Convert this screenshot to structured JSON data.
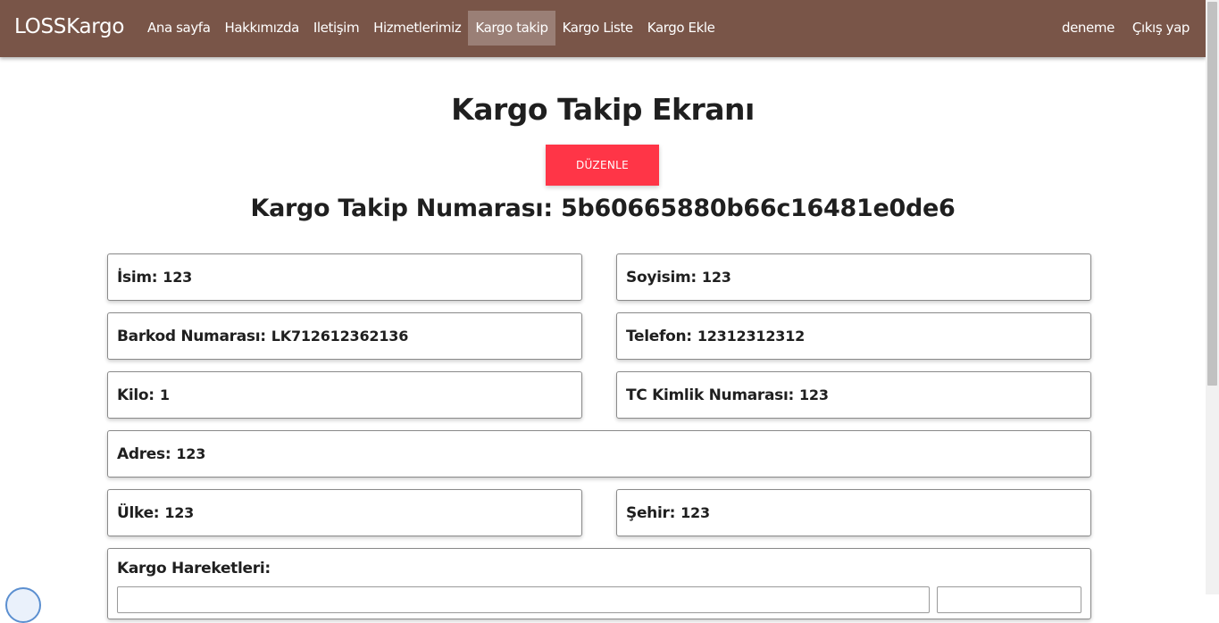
{
  "nav": {
    "brand": "LOSSKargo",
    "links": [
      {
        "label": "Ana sayfa"
      },
      {
        "label": "Hakkımızda"
      },
      {
        "label": "Iletişim"
      },
      {
        "label": "Hizmetlerimiz"
      },
      {
        "label": "Kargo takip"
      },
      {
        "label": "Kargo Liste"
      },
      {
        "label": "Kargo Ekle"
      }
    ],
    "active": "Kargo takip",
    "user": "deneme",
    "logout": "Çıkış yap"
  },
  "main": {
    "title": "Kargo Takip Ekranı",
    "edit_button": "DÜZENLE",
    "tracking_label": "Kargo Takip Numarası:",
    "tracking_number": "5b60665880b66c16481e0de6",
    "fields": {
      "isim": {
        "label": "İsim:",
        "value": "123"
      },
      "soyisim": {
        "label": "Soyisim:",
        "value": "123"
      },
      "barkod": {
        "label": "Barkod Numarası:",
        "value": "LK712612362136"
      },
      "telefon": {
        "label": "Telefon:",
        "value": "12312312312"
      },
      "kilo": {
        "label": "Kilo:",
        "value": "1"
      },
      "tc": {
        "label": "TC Kimlik Numarası:",
        "value": "123"
      },
      "adres": {
        "label": "Adres:",
        "value": "123"
      },
      "ulke": {
        "label": "Ülke:",
        "value": "123"
      },
      "sehir": {
        "label": "Şehir:",
        "value": "123"
      }
    },
    "movements_label": "Kargo Hareketleri:"
  },
  "colors": {
    "navbar": "#795548",
    "edit_button": "#ff3547"
  }
}
